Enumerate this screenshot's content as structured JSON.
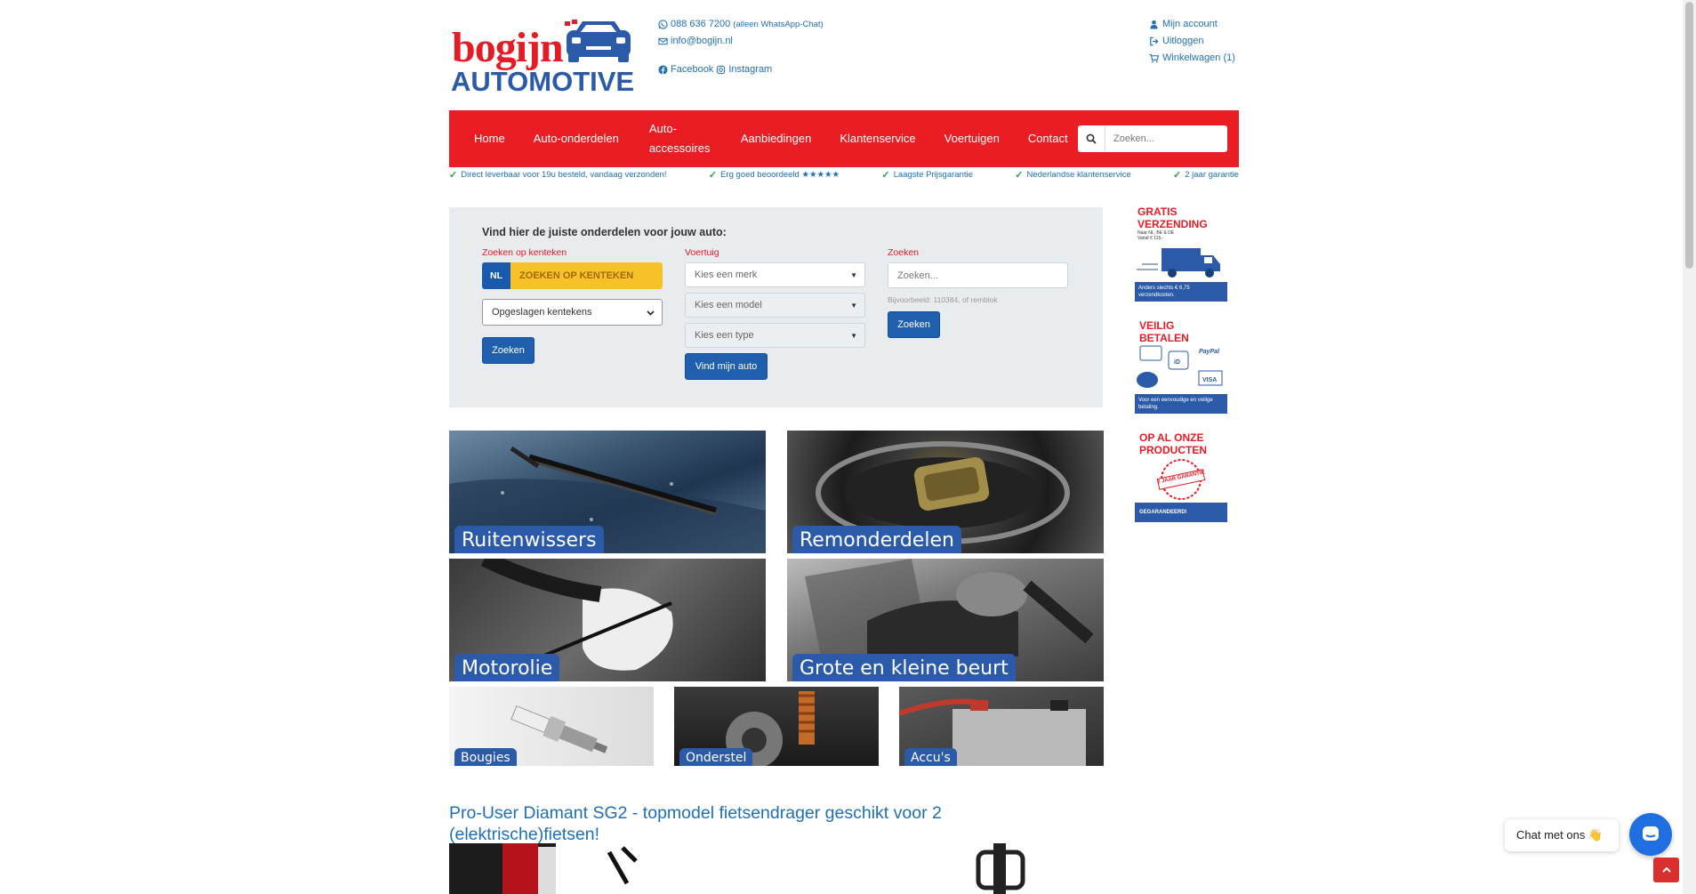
{
  "brand": {
    "name_top": "bogijn",
    "name_bottom": "AUTOMOTIVE"
  },
  "contact": {
    "phone": "088 636 7200",
    "phone_note": "(alleen WhatsApp-Chat)",
    "email": "info@bogijn.nl",
    "facebook": "Facebook",
    "instagram": "Instagram"
  },
  "account": {
    "my_account": "Mijn account",
    "logout": "Uitloggen",
    "cart": "Winkelwagen (1)"
  },
  "nav": {
    "items": [
      "Home",
      "Auto-onderdelen",
      "Auto-\naccessoires",
      "Aanbiedingen",
      "Klantenservice",
      "Voertuigen",
      "Contact"
    ],
    "search_placeholder": "Zoeken..."
  },
  "usps": [
    "Direct leverbaar voor 19u besteld, vandaag verzonden!",
    "Erg goed beoordeeld ★★★★★",
    "Laagste Prijsgarantie",
    "Nederlandse klantenservice",
    "2 jaar garantie"
  ],
  "finder": {
    "heading": "Vind hier de juiste onderdelen voor jouw auto:",
    "plate_label": "Zoeken op kenteken",
    "plate_country": "NL",
    "plate_text": "ZOEKEN OP KENTEKEN",
    "saved_plates": "Opgeslagen kentekens",
    "plate_button": "Zoeken",
    "vehicle_label": "Voertuig",
    "brand_select": "Kies een merk",
    "model_select": "Kies een model",
    "type_select": "Kies een type",
    "vehicle_button": "Vind mijn auto",
    "search_label": "Zoeken",
    "search_placeholder": "Zoeken...",
    "search_hint": "Bijvoorbeeld: 110384, of remblok",
    "search_button": "Zoeken"
  },
  "tiles": {
    "wipers": "Ruitenwissers",
    "brakes": "Remonderdelen",
    "oil": "Motorolie",
    "service": "Grote en kleine beurt",
    "plugs": "Bougies",
    "chassis": "Onderstel",
    "battery": "Accu's"
  },
  "sidebar": {
    "shipping_title_1": "GRATIS",
    "shipping_title_2": "VERZENDING",
    "shipping_sub": "Naar NL, BE & DE Vanaf € 115,-",
    "shipping_note": "Anders slechts € 6,75 verzendkosten.",
    "pay_title_1": "VEILIG",
    "pay_title_2": "BETALEN",
    "pay_note": "Voor een eenvoudige en veilige betaling.",
    "guar_title_1": "OP AL ONZE",
    "guar_title_2": "PRODUCTEN",
    "guar_stamp": "2 JAAR GARANTIE",
    "guar_note": "GEGARANDEERD!"
  },
  "product": {
    "title": "Pro-User Diamant SG2 - topmodel fietsendrager geschikt voor 2 (elektrische)fietsen!"
  },
  "chat": {
    "label": "Chat met ons 👋"
  },
  "colors": {
    "brand_red": "#ea1d24",
    "brand_blue": "#2b5ba8",
    "link": "#1f6fb7",
    "plate_yellow": "#f7c228"
  }
}
